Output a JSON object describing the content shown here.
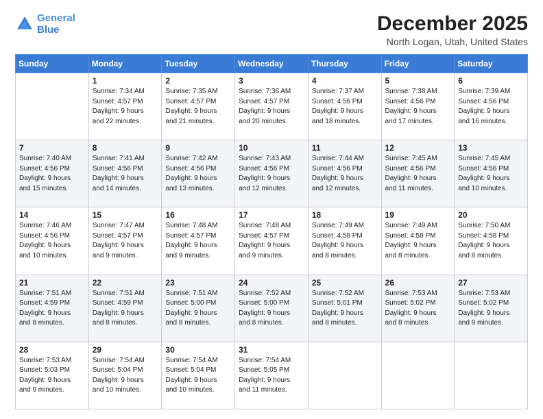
{
  "logo": {
    "line1": "General",
    "line2": "Blue"
  },
  "title": "December 2025",
  "location": "North Logan, Utah, United States",
  "days_header": [
    "Sunday",
    "Monday",
    "Tuesday",
    "Wednesday",
    "Thursday",
    "Friday",
    "Saturday"
  ],
  "weeks": [
    [
      {
        "day": "",
        "info": ""
      },
      {
        "day": "1",
        "info": "Sunrise: 7:34 AM\nSunset: 4:57 PM\nDaylight: 9 hours\nand 22 minutes."
      },
      {
        "day": "2",
        "info": "Sunrise: 7:35 AM\nSunset: 4:57 PM\nDaylight: 9 hours\nand 21 minutes."
      },
      {
        "day": "3",
        "info": "Sunrise: 7:36 AM\nSunset: 4:57 PM\nDaylight: 9 hours\nand 20 minutes."
      },
      {
        "day": "4",
        "info": "Sunrise: 7:37 AM\nSunset: 4:56 PM\nDaylight: 9 hours\nand 18 minutes."
      },
      {
        "day": "5",
        "info": "Sunrise: 7:38 AM\nSunset: 4:56 PM\nDaylight: 9 hours\nand 17 minutes."
      },
      {
        "day": "6",
        "info": "Sunrise: 7:39 AM\nSunset: 4:56 PM\nDaylight: 9 hours\nand 16 minutes."
      }
    ],
    [
      {
        "day": "7",
        "info": "Sunrise: 7:40 AM\nSunset: 4:56 PM\nDaylight: 9 hours\nand 15 minutes."
      },
      {
        "day": "8",
        "info": "Sunrise: 7:41 AM\nSunset: 4:56 PM\nDaylight: 9 hours\nand 14 minutes."
      },
      {
        "day": "9",
        "info": "Sunrise: 7:42 AM\nSunset: 4:56 PM\nDaylight: 9 hours\nand 13 minutes."
      },
      {
        "day": "10",
        "info": "Sunrise: 7:43 AM\nSunset: 4:56 PM\nDaylight: 9 hours\nand 12 minutes."
      },
      {
        "day": "11",
        "info": "Sunrise: 7:44 AM\nSunset: 4:56 PM\nDaylight: 9 hours\nand 12 minutes."
      },
      {
        "day": "12",
        "info": "Sunrise: 7:45 AM\nSunset: 4:56 PM\nDaylight: 9 hours\nand 11 minutes."
      },
      {
        "day": "13",
        "info": "Sunrise: 7:45 AM\nSunset: 4:56 PM\nDaylight: 9 hours\nand 10 minutes."
      }
    ],
    [
      {
        "day": "14",
        "info": "Sunrise: 7:46 AM\nSunset: 4:56 PM\nDaylight: 9 hours\nand 10 minutes."
      },
      {
        "day": "15",
        "info": "Sunrise: 7:47 AM\nSunset: 4:57 PM\nDaylight: 9 hours\nand 9 minutes."
      },
      {
        "day": "16",
        "info": "Sunrise: 7:48 AM\nSunset: 4:57 PM\nDaylight: 9 hours\nand 9 minutes."
      },
      {
        "day": "17",
        "info": "Sunrise: 7:48 AM\nSunset: 4:57 PM\nDaylight: 9 hours\nand 9 minutes."
      },
      {
        "day": "18",
        "info": "Sunrise: 7:49 AM\nSunset: 4:58 PM\nDaylight: 9 hours\nand 8 minutes."
      },
      {
        "day": "19",
        "info": "Sunrise: 7:49 AM\nSunset: 4:58 PM\nDaylight: 9 hours\nand 8 minutes."
      },
      {
        "day": "20",
        "info": "Sunrise: 7:50 AM\nSunset: 4:58 PM\nDaylight: 9 hours\nand 8 minutes."
      }
    ],
    [
      {
        "day": "21",
        "info": "Sunrise: 7:51 AM\nSunset: 4:59 PM\nDaylight: 9 hours\nand 8 minutes."
      },
      {
        "day": "22",
        "info": "Sunrise: 7:51 AM\nSunset: 4:59 PM\nDaylight: 9 hours\nand 8 minutes."
      },
      {
        "day": "23",
        "info": "Sunrise: 7:51 AM\nSunset: 5:00 PM\nDaylight: 9 hours\nand 8 minutes."
      },
      {
        "day": "24",
        "info": "Sunrise: 7:52 AM\nSunset: 5:00 PM\nDaylight: 9 hours\nand 8 minutes."
      },
      {
        "day": "25",
        "info": "Sunrise: 7:52 AM\nSunset: 5:01 PM\nDaylight: 9 hours\nand 8 minutes."
      },
      {
        "day": "26",
        "info": "Sunrise: 7:53 AM\nSunset: 5:02 PM\nDaylight: 9 hours\nand 8 minutes."
      },
      {
        "day": "27",
        "info": "Sunrise: 7:53 AM\nSunset: 5:02 PM\nDaylight: 9 hours\nand 9 minutes."
      }
    ],
    [
      {
        "day": "28",
        "info": "Sunrise: 7:53 AM\nSunset: 5:03 PM\nDaylight: 9 hours\nand 9 minutes."
      },
      {
        "day": "29",
        "info": "Sunrise: 7:54 AM\nSunset: 5:04 PM\nDaylight: 9 hours\nand 10 minutes."
      },
      {
        "day": "30",
        "info": "Sunrise: 7:54 AM\nSunset: 5:04 PM\nDaylight: 9 hours\nand 10 minutes."
      },
      {
        "day": "31",
        "info": "Sunrise: 7:54 AM\nSunset: 5:05 PM\nDaylight: 9 hours\nand 11 minutes."
      },
      {
        "day": "",
        "info": ""
      },
      {
        "day": "",
        "info": ""
      },
      {
        "day": "",
        "info": ""
      }
    ]
  ]
}
